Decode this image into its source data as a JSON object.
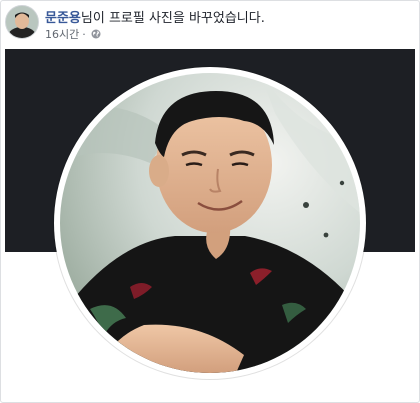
{
  "post": {
    "author": "문준용",
    "action_text": "님이 프로필 사진을 바꾸었습니다.",
    "timestamp": "16시간",
    "separator": "·",
    "privacy_icon": "globe-icon"
  },
  "colors": {
    "author_link": "#385898",
    "cover_background": "#1d1f24",
    "meta_text": "#616770"
  }
}
